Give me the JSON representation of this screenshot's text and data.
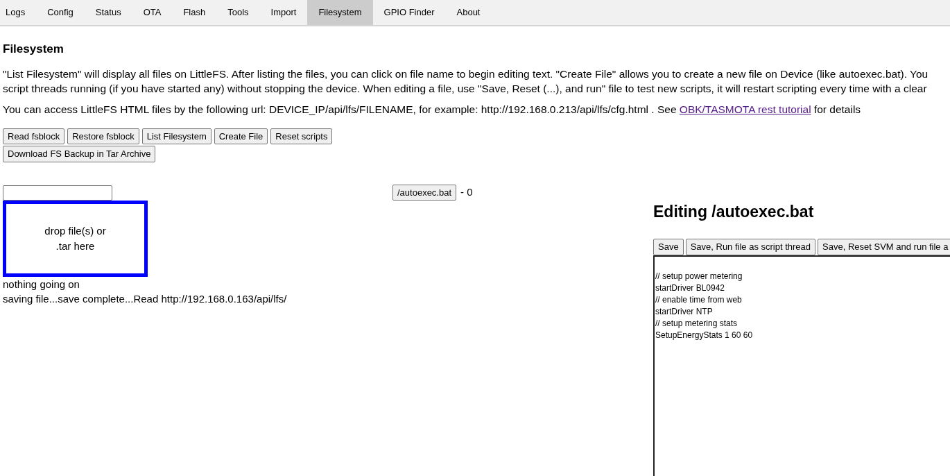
{
  "tabs": [
    {
      "label": "Logs",
      "selected": false
    },
    {
      "label": "Config",
      "selected": false
    },
    {
      "label": "Status",
      "selected": false
    },
    {
      "label": "OTA",
      "selected": false
    },
    {
      "label": "Flash",
      "selected": false
    },
    {
      "label": "Tools",
      "selected": false
    },
    {
      "label": "Import",
      "selected": false
    },
    {
      "label": "Filesystem",
      "selected": true
    },
    {
      "label": "GPIO Finder",
      "selected": false
    },
    {
      "label": "About",
      "selected": false
    }
  ],
  "heading": "Filesystem",
  "description_lines": [
    "\"List Filesystem\" will display all files on LittleFS. After listing the files, you can click on file name to begin editing text. \"Create File\" allows you to create a new file on Device (like autoexec.bat). You",
    "script threads running (if you have started any) without stopping the device. When editing a file, use \"Save, Reset (...), and run\" file to test new scripts, it will restart scripting every time with a clear"
  ],
  "access_note": {
    "text": "You can access LittleFS HTML files by the following url: DEVICE_IP/api/lfs/FILENAME, for example: http://192.168.0.213/api/lfs/cfg.html . See",
    "link": "OBK/TASMOTA rest tutorial",
    "suffix": "for details"
  },
  "actions": [
    "Read fsblock",
    "Restore fsblock",
    "List Filesystem",
    "Create File",
    "Reset scripts",
    "Download FS Backup in Tar Archive"
  ],
  "file_entry": {
    "name": "/autoexec.bat",
    "size": "- 0"
  },
  "drop_zone": {
    "lines": [
      "drop file(s) or",
      ".tar here"
    ]
  },
  "status_lines": [
    "nothing going on",
    "saving file...save complete...Read http://192.168.0.163/api/lfs/"
  ],
  "editor": {
    "title": "Editing /autoexec.bat",
    "buttons": [
      "Save",
      "Save, Run file as script thread",
      "Save, Reset SVM and run file a"
    ],
    "code_lines": [
      "// setup power metering",
      "startDriver BL0942",
      "// enable time from web",
      "startDriver NTP",
      "// setup metering stats",
      "SetupEnergyStats 1 60 60"
    ]
  }
}
